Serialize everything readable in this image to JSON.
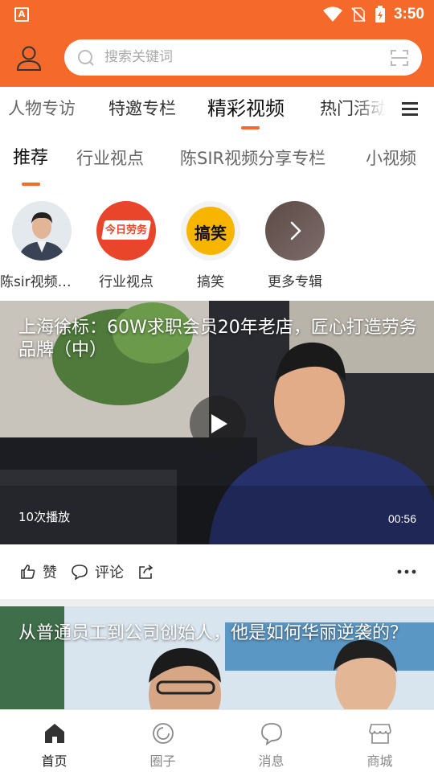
{
  "status_bar": {
    "app_badge": "A",
    "time": "3:50"
  },
  "header": {
    "search_placeholder": "搜索关键词"
  },
  "category_tabs": [
    {
      "label": "人物专访",
      "active": false
    },
    {
      "label": "特邀专栏",
      "active": false
    },
    {
      "label": "精彩视频",
      "active": true
    },
    {
      "label": "热门活动",
      "active": false
    }
  ],
  "sub_tabs": [
    {
      "label": "推荐",
      "active": true
    },
    {
      "label": "行业视点",
      "active": false
    },
    {
      "label": "陈SIR视频分享专栏",
      "active": false
    },
    {
      "label": "小视频",
      "active": false
    }
  ],
  "albums": [
    {
      "name": "陈sir视频分享"
    },
    {
      "name": "行业视点",
      "logo_text": "今日劳务"
    },
    {
      "name": "搞笑",
      "logo_text": "搞笑"
    },
    {
      "name": "更多专辑"
    }
  ],
  "videos": [
    {
      "title": "上海徐标：60W求职会员20年老店，匠心打造劳务品牌（中）",
      "plays": "10次播放",
      "duration": "00:56"
    },
    {
      "title": "从普通员工到公司创始人，他是如何华丽逆袭的？"
    }
  ],
  "actions": {
    "like": "赞",
    "comment": "评论"
  },
  "bottom_nav": [
    {
      "label": "首页",
      "icon": "home-icon",
      "active": true
    },
    {
      "label": "圈子",
      "icon": "circle-icon",
      "active": false
    },
    {
      "label": "消息",
      "icon": "message-icon",
      "active": false
    },
    {
      "label": "商城",
      "icon": "shop-icon",
      "active": false
    }
  ],
  "colors": {
    "brand": "#f56a2a",
    "bg": "#ffffff",
    "divider": "#efefef"
  }
}
